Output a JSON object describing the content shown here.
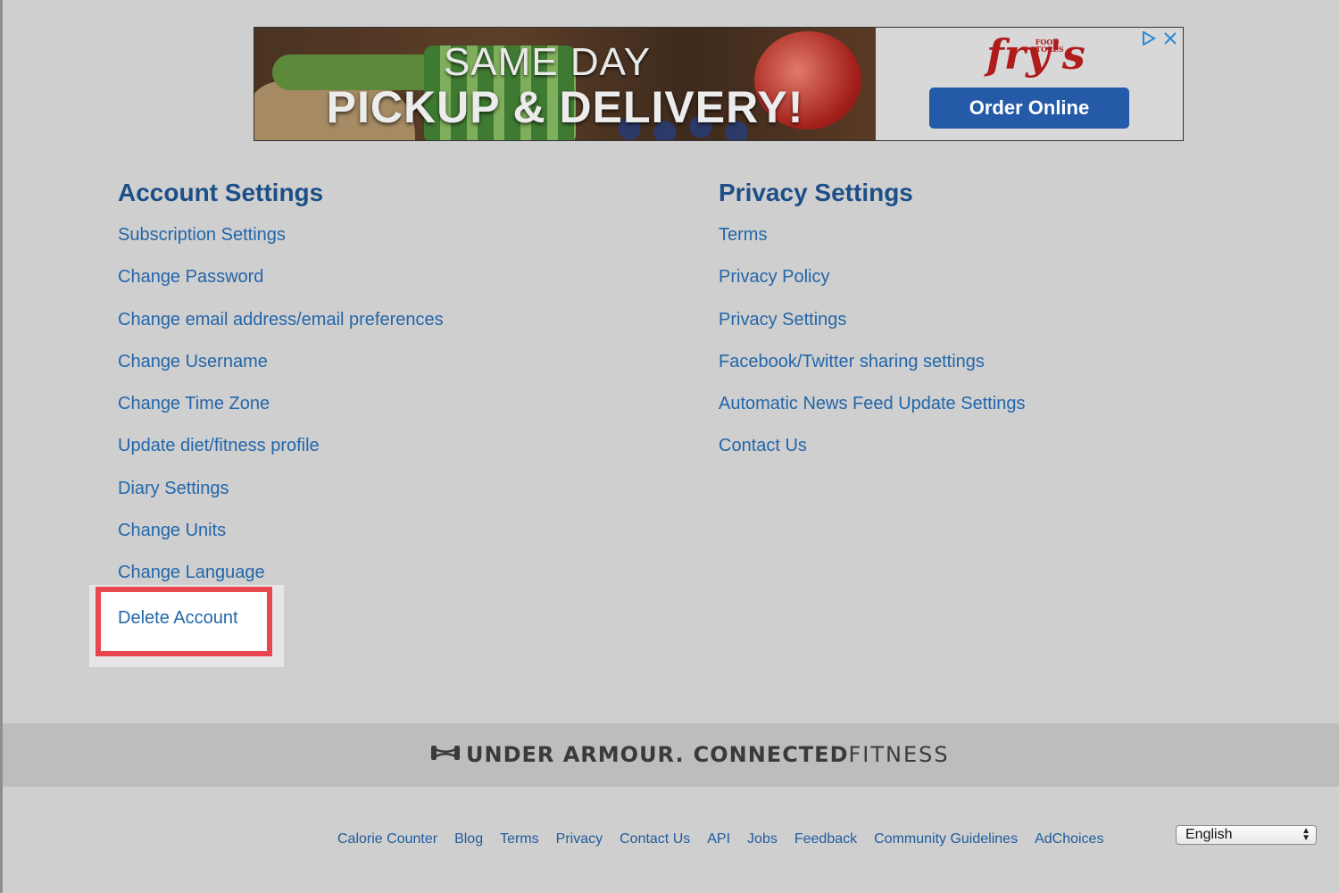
{
  "ad": {
    "headline_line1": "SAME DAY",
    "headline_line2": "PICKUP & DELIVERY!",
    "brand_logo": "fry's",
    "brand_logo_tag": "FOOD STORES",
    "cta_label": "Order Online",
    "icons": [
      "adchoices-icon",
      "close-icon"
    ],
    "cta_color": "#245aa8"
  },
  "account_settings": {
    "title": "Account Settings",
    "items": [
      "Subscription Settings",
      "Change Password",
      "Change email address/email preferences",
      "Change Username",
      "Change Time Zone",
      "Update diet/fitness profile",
      "Diary Settings",
      "Change Units",
      "Change Language"
    ],
    "delete_label": "Delete Account"
  },
  "privacy_settings": {
    "title": "Privacy Settings",
    "items": [
      "Terms",
      "Privacy Policy",
      "Privacy Settings",
      "Facebook/Twitter sharing settings",
      "Automatic News Feed Update Settings",
      "Contact Us"
    ]
  },
  "footer": {
    "brand_part1": "UNDER ARMOUR.",
    "brand_part2": "CONNECTED",
    "brand_part3": "FITNESS",
    "links": [
      "Calorie Counter",
      "Blog",
      "Terms",
      "Privacy",
      "Contact Us",
      "API",
      "Jobs",
      "Feedback",
      "Community Guidelines",
      "AdChoices"
    ],
    "language_selected": "English"
  },
  "colors": {
    "heading": "#1d4f87",
    "link": "#2366aa",
    "highlight_border": "#e8474f",
    "background": "#cfcfcf"
  }
}
